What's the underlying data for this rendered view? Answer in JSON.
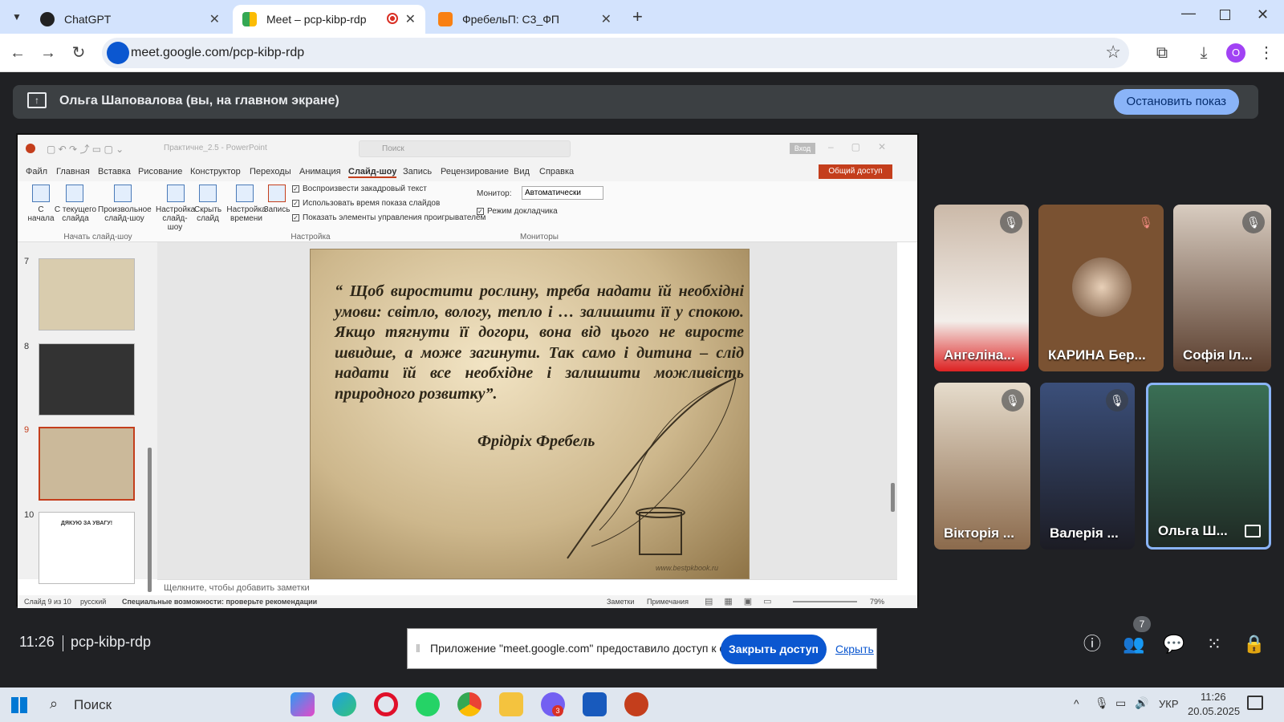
{
  "browser": {
    "tabs": [
      {
        "title": "ChatGPT",
        "active": false
      },
      {
        "title": "Meet – pcp-kibp-rdp",
        "active": true
      },
      {
        "title": "ФребельП: С3_ФП",
        "active": false
      }
    ],
    "url": "meet.google.com/pcp-kibp-rdp",
    "profile_initial": "O"
  },
  "meet": {
    "presenter_label": "Ольга Шаповалова (вы, на главном экране)",
    "stop_button": "Остановить показ",
    "time": "11:26",
    "meeting_code": "pcp-kibp-rdp",
    "participants_count": "7",
    "share_popup": {
      "text": "Приложение \"meet.google.com\" предоставило доступ к окну.",
      "close_button": "Закрыть доступ",
      "hide_link": "Скрыть"
    },
    "participants": [
      {
        "name": "Ангеліна...",
        "muted": true
      },
      {
        "name": "КАРИНА Бер...",
        "muted": true
      },
      {
        "name": "Софія Іл...",
        "muted": true
      },
      {
        "name": "Вікторія ...",
        "muted": true
      },
      {
        "name": "Валерія ...",
        "muted": true
      },
      {
        "name": "Ольга Ш...",
        "muted": false
      }
    ]
  },
  "ppt": {
    "title": "Практичне_2.5 - PowerPoint",
    "search_placeholder": "Поиск",
    "signin": "Вход",
    "share": "Общий доступ",
    "menu": [
      "Файл",
      "Главная",
      "Вставка",
      "Рисование",
      "Конструктор",
      "Переходы",
      "Анимация",
      "Слайд-шоу",
      "Запись",
      "Рецензирование",
      "Вид",
      "Справка"
    ],
    "ribbon": {
      "from_start": "С начала",
      "from_current": "С текущего слайда",
      "custom": "Произвольное слайд-шоу",
      "group_start": "Начать слайд-шоу",
      "setup": "Настройка слайд-шоу",
      "hide": "Скрыть слайд",
      "timing": "Настройка времени",
      "record": "Запись",
      "cb1": "Воспроизвести закадровый текст",
      "cb2": "Использовать время показа слайдов",
      "cb3": "Показать элементы управления проигрывателем",
      "group_setup": "Настройка",
      "monitor_label": "Монитор:",
      "monitor_value": "Автоматически",
      "presenter_view": "Режим докладчика",
      "group_monitors": "Мониторы"
    },
    "slide_numbers": [
      "7",
      "8",
      "9",
      "10"
    ],
    "thumb10_text": "ДЯКУЮ ЗА УВАГУ!",
    "quote": "“ Щоб виростити рослину, треба надати їй необхідні умови: світло, вологу, тепло і … залишити її у спокою. Якщо тягнути її догори, вона від цього не виросте швидше, а може загинути. Так само і дитина – слід надати їй все необхідне і залишити можливість природного розвитку”.",
    "author": "Фрідріх Фребель",
    "watermark": "www.bestpkbook.ru",
    "notes_placeholder": "Щелкните, чтобы добавить заметки",
    "status": {
      "slide": "Слайд 9 из 10",
      "lang": "русский",
      "accessibility": "Специальные возможности: проверьте рекомендации",
      "notes": "Заметки",
      "comments": "Примечания",
      "zoom": "79%"
    }
  },
  "taskbar": {
    "search": "Поиск",
    "lang": "УКР",
    "time": "11:26",
    "date": "20.05.2025",
    "badge": "3"
  }
}
